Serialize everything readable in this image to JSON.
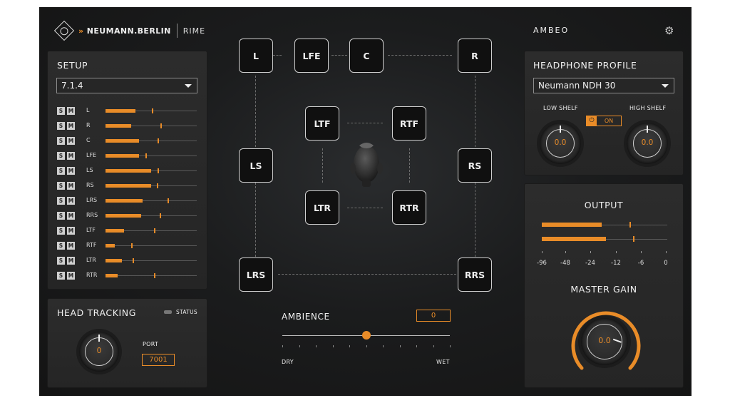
{
  "header": {
    "brand": "NEUMANN.BERLIN",
    "product": "RIME",
    "right_title": "AMBEO",
    "settings_icon": "gear-icon"
  },
  "setup": {
    "title": "SETUP",
    "format": "7.1.4",
    "solo_label": "S",
    "mute_label": "M",
    "channels": [
      {
        "name": "L",
        "level": 0.33,
        "peak": 0.51
      },
      {
        "name": "R",
        "level": 0.28,
        "peak": 0.6
      },
      {
        "name": "C",
        "level": 0.37,
        "peak": 0.57
      },
      {
        "name": "LFE",
        "level": 0.37,
        "peak": 0.44
      },
      {
        "name": "LS",
        "level": 0.5,
        "peak": 0.57
      },
      {
        "name": "RS",
        "level": 0.5,
        "peak": 0.56
      },
      {
        "name": "LRS",
        "level": 0.41,
        "peak": 0.68
      },
      {
        "name": "RRS",
        "level": 0.39,
        "peak": 0.59
      },
      {
        "name": "LTF",
        "level": 0.2,
        "peak": 0.53
      },
      {
        "name": "RTF",
        "level": 0.1,
        "peak": 0.28
      },
      {
        "name": "LTR",
        "level": 0.18,
        "peak": 0.3
      },
      {
        "name": "RTR",
        "level": 0.13,
        "peak": 0.53
      }
    ]
  },
  "head_tracking": {
    "title": "HEAD TRACKING",
    "status_label": "STATUS",
    "knob_value": "0",
    "port_label": "PORT",
    "port_value": "7001"
  },
  "speakers": {
    "L": "L",
    "LFE": "LFE",
    "C": "C",
    "R": "R",
    "LTF": "LTF",
    "RTF": "RTF",
    "LS": "LS",
    "RS": "RS",
    "LTR": "LTR",
    "RTR": "RTR",
    "LRS": "LRS",
    "RRS": "RRS"
  },
  "ambience": {
    "label": "AMBIENCE",
    "value": "0",
    "dry_label": "DRY",
    "wet_label": "WET",
    "position": 0.5
  },
  "headphone_profile": {
    "title": "HEADPHONE PROFILE",
    "model": "Neumann NDH 30",
    "low_shelf_label": "LOW SHELF",
    "high_shelf_label": "HIGH SHELF",
    "low_shelf_value": "0.0",
    "high_shelf_value": "0.0",
    "toggle_label": "ON"
  },
  "output": {
    "title": "OUTPUT",
    "scale": [
      "-96",
      "-48",
      "-24",
      "-12",
      "-6",
      "0"
    ],
    "meters": [
      {
        "level": 0.48,
        "peak": 0.7
      },
      {
        "level": 0.51,
        "peak": 0.73
      }
    ],
    "master_gain_label": "MASTER GAIN",
    "master_gain_value": "0.0"
  },
  "colors": {
    "accent": "#e98c28",
    "panel": "#2a2a2a",
    "background": "#161616"
  }
}
